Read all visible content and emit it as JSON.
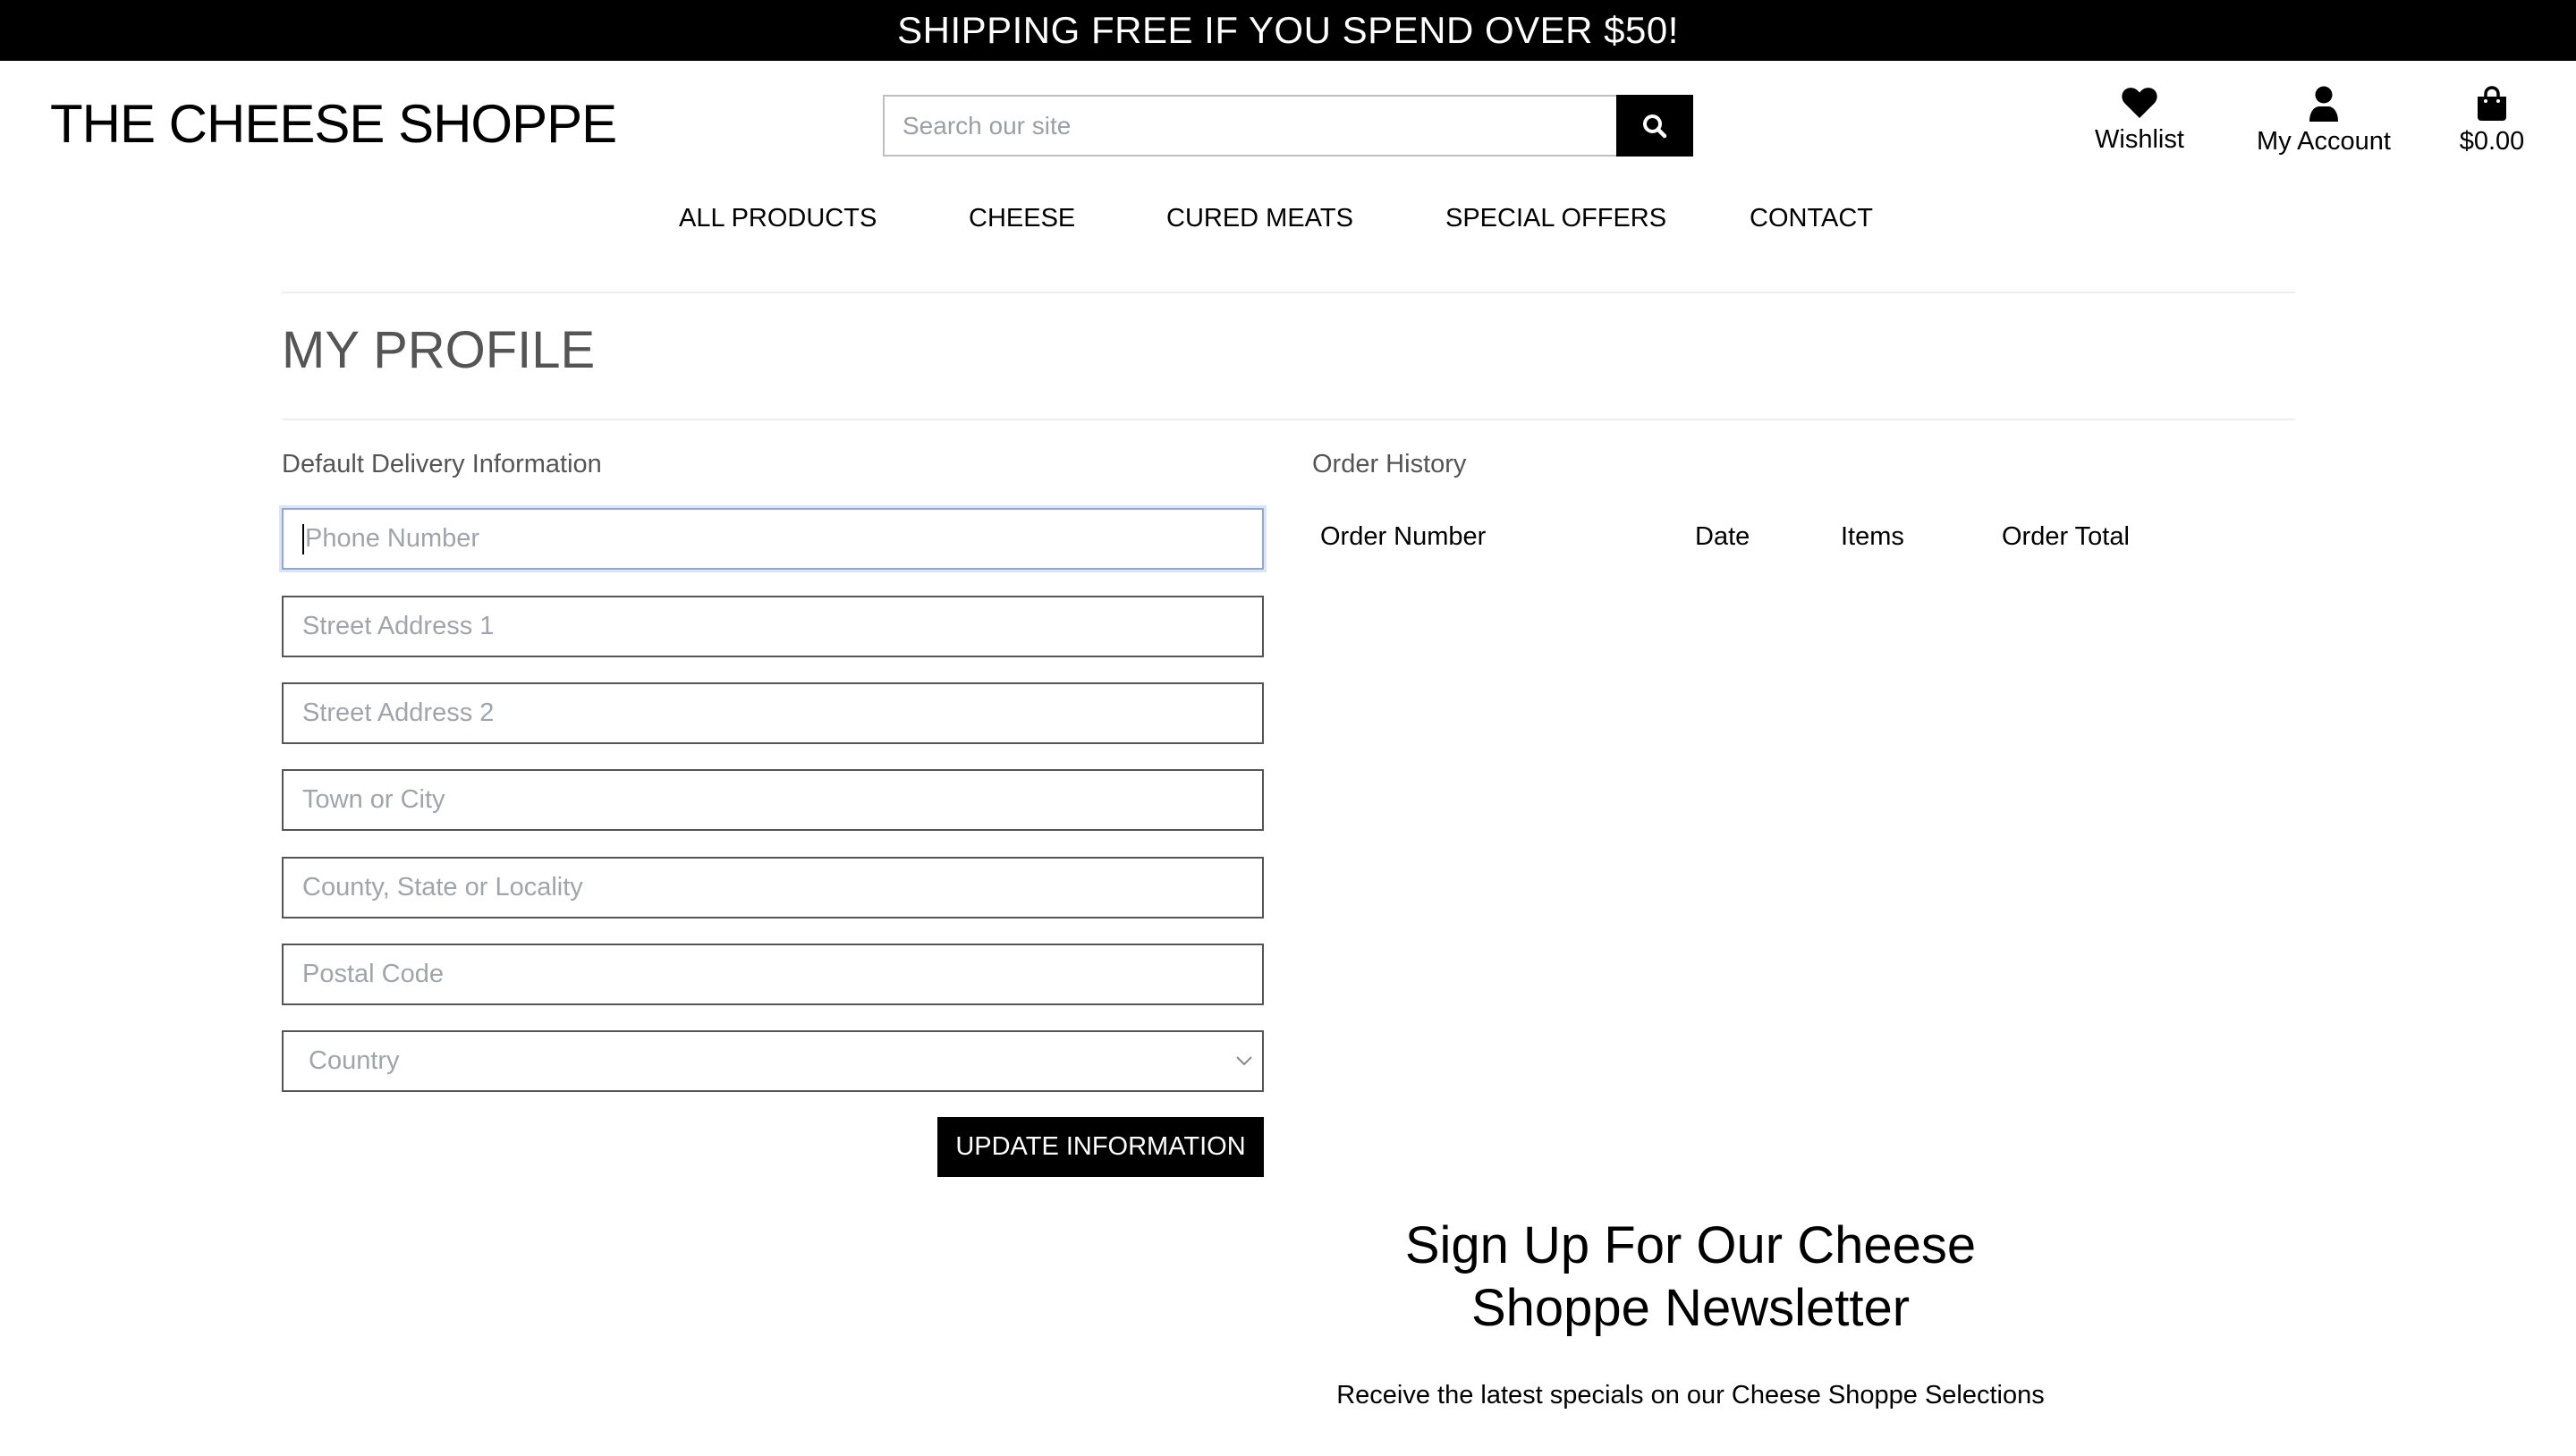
{
  "promo": {
    "text": "SHIPPING FREE IF YOU SPEND OVER $50!"
  },
  "header": {
    "brand": "THE CHEESE SHOPPE",
    "search": {
      "placeholder": "Search our site",
      "icon": "search-icon"
    },
    "actions": [
      {
        "label": "Wishlist",
        "icon": "heart-icon"
      },
      {
        "label": "My Account",
        "icon": "user-icon"
      },
      {
        "label": "$0.00",
        "icon": "shopping-bag-icon"
      }
    ]
  },
  "nav": {
    "items": [
      {
        "label": "ALL PRODUCTS"
      },
      {
        "label": "CHEESE"
      },
      {
        "label": "CURED MEATS"
      },
      {
        "label": "SPECIAL OFFERS"
      },
      {
        "label": "CONTACT"
      }
    ]
  },
  "profile": {
    "title": "MY PROFILE",
    "delivery": {
      "heading": "Default Delivery Information",
      "fields": [
        {
          "placeholder": "Phone Number",
          "value": ""
        },
        {
          "placeholder": "Street Address 1",
          "value": ""
        },
        {
          "placeholder": "Street Address 2",
          "value": ""
        },
        {
          "placeholder": "Town or City",
          "value": ""
        },
        {
          "placeholder": "County, State or Locality",
          "value": ""
        },
        {
          "placeholder": "Postal Code",
          "value": ""
        },
        {
          "placeholder": "Country",
          "value": ""
        }
      ],
      "submit_label": "UPDATE INFORMATION"
    },
    "orders": {
      "heading": "Order History",
      "columns": [
        "Order Number",
        "Date",
        "Items",
        "Order Total"
      ],
      "rows": []
    }
  },
  "newsletter": {
    "title_line1": "Sign Up For Our Cheese",
    "title_line2": "Shoppe Newsletter",
    "subtitle": "Receive the latest specials on our Cheese Shoppe Selections"
  },
  "colors": {
    "promo_bg": "#000000",
    "button_bg": "#000000",
    "focus_border": "#90a8d8",
    "title_gray": "#555555",
    "placeholder_gray": "#a0a4ab"
  }
}
